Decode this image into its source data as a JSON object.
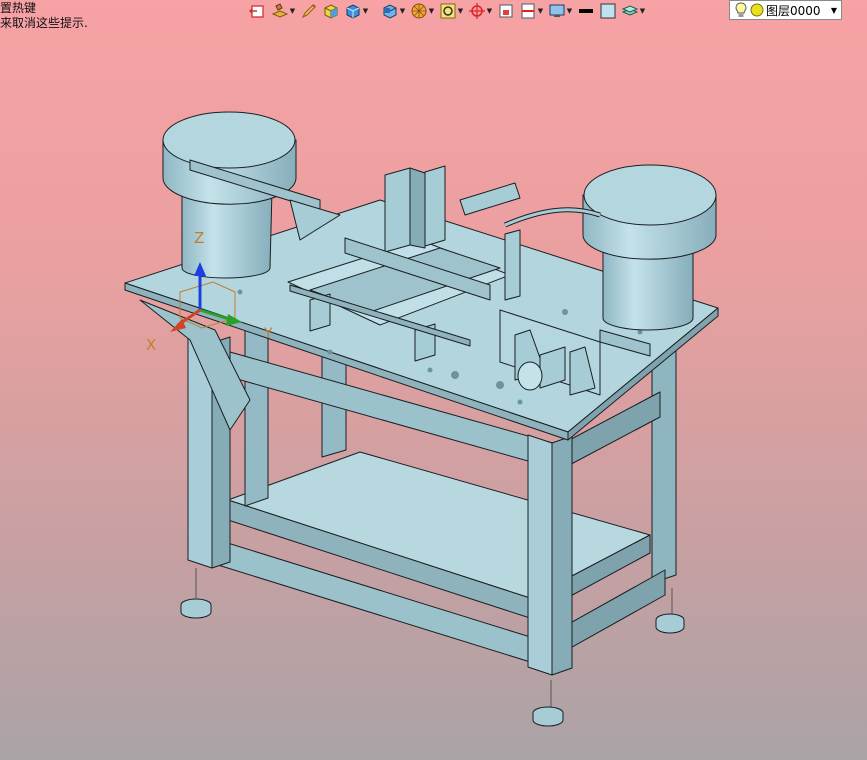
{
  "hints": {
    "line1": "置热键",
    "line2": "来取消这些提示."
  },
  "toolbar": {
    "icons": [
      "exit-sketch-icon",
      "layer-paint-icon",
      "pencil-icon",
      "box-yellow-icon",
      "box-blue-icon",
      "view-cube-icon",
      "render-sphere-icon",
      "zoom-fit-icon",
      "snap-target-icon",
      "frame-icon",
      "section-icon",
      "display-mode-icon",
      "line-color-swatch",
      "fill-color-swatch",
      "layer-stack-icon"
    ],
    "line_color": "#000000",
    "fill_color": "#bfe2f0"
  },
  "layer": {
    "name": "图层0000"
  },
  "triad": {
    "z_label": "Z",
    "x_label": "X",
    "y_label": "Y",
    "z_color": "#1c3fe0",
    "x_color": "#d2442a",
    "y_color": "#2aa02a"
  },
  "model": {
    "color": "#a6ccd6",
    "edge_color": "#1a1f22"
  }
}
